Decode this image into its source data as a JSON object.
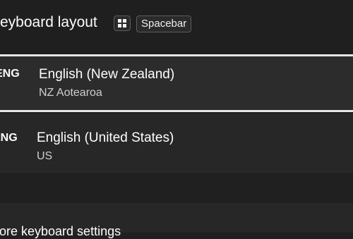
{
  "header": {
    "title": "Keyboard layout",
    "key_icons": [
      "windows-key-icon"
    ],
    "space_key_label": "Spacebar"
  },
  "layouts": [
    {
      "code": "ENG",
      "name": "English (New Zealand)",
      "detail": "NZ Aotearoa",
      "selected": true
    },
    {
      "code": "ENG",
      "name": "English (United States)",
      "detail": "US",
      "selected": false
    }
  ],
  "footer": {
    "link_label": "More keyboard settings"
  }
}
